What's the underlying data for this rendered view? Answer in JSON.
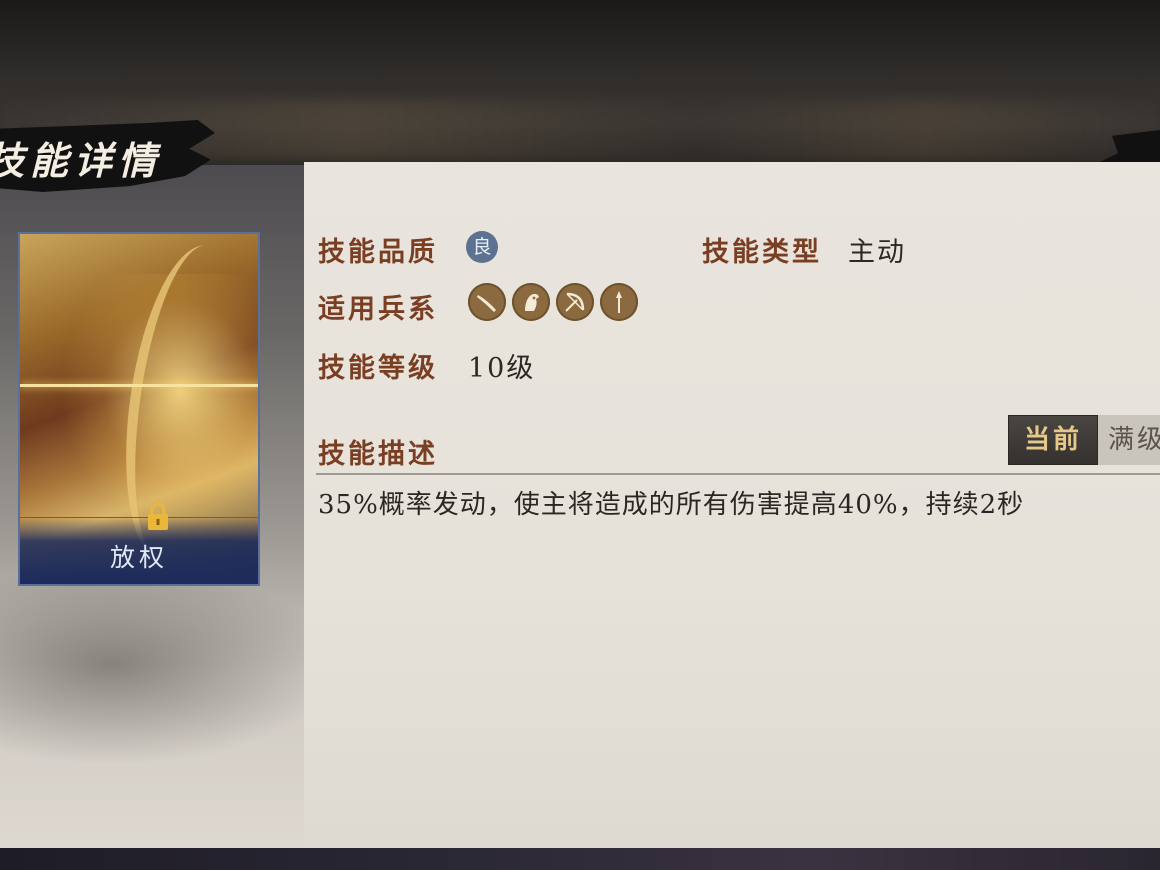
{
  "header": {
    "title": "技能详情"
  },
  "card": {
    "name": "放权"
  },
  "info": {
    "quality_label": "技能品质",
    "quality_badge": "良",
    "type_label": "技能类型",
    "type_value": "主动",
    "troops_label": "适用兵系",
    "troop_icons": [
      "infantry-blade-icon",
      "cavalry-horse-icon",
      "archer-bow-icon",
      "spear-icon"
    ],
    "level_label": "技能等级",
    "level_value": "10级"
  },
  "description": {
    "label": "技能描述",
    "tab_current": "当前",
    "tab_max": "满级",
    "text": "35%概率发动，使主将造成的所有伤害提高40%，持续2秒"
  },
  "colors": {
    "label": "#7a3f22",
    "quality_badge": "#5d7290",
    "troop_icon_bg": "#8a6a3e",
    "card_border": "#5a6f9c"
  }
}
